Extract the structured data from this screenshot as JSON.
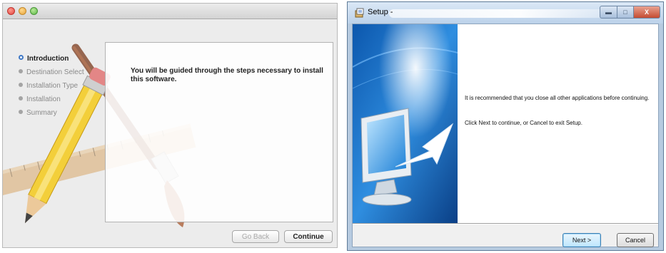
{
  "mac_installer": {
    "window_controls": [
      "close",
      "minimize",
      "zoom"
    ],
    "steps": [
      {
        "label": "Introduction",
        "active": true
      },
      {
        "label": "Destination Select",
        "active": false
      },
      {
        "label": "Installation Type",
        "active": false
      },
      {
        "label": "Installation",
        "active": false
      },
      {
        "label": "Summary",
        "active": false
      }
    ],
    "body_text": "You will be guided through the steps necessary to install this software.",
    "buttons": {
      "back": "Go Back",
      "continue": "Continue"
    },
    "colors": {
      "active_step": "#3f78c5",
      "close": "#e0443e",
      "minimize": "#e6a23a",
      "zoom": "#5cb845"
    }
  },
  "win_setup": {
    "title": "Setup -",
    "caption_buttons": {
      "minimize": "▬",
      "maximize": "□",
      "close": "X"
    },
    "paragraphs": [
      "It is recommended that you close all other applications before continuing.",
      "Click Next to continue, or Cancel to exit Setup."
    ],
    "buttons": {
      "next": "Next >",
      "cancel": "Cancel"
    },
    "colors": {
      "titlebar": "#bcd2ea",
      "close_button": "#c44b31",
      "art_panel": "#1a6fc0"
    }
  }
}
